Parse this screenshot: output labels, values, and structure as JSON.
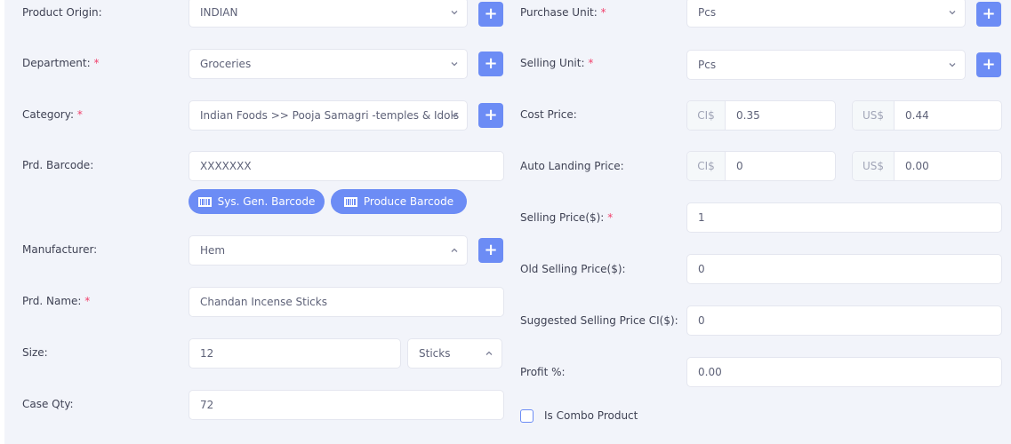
{
  "colors": {
    "accent": "#6c8cf5",
    "required": "#f1416c",
    "background": "#f2f4fa",
    "border": "#e4e6ef"
  },
  "left": {
    "product_origin": {
      "label": "Product Origin:",
      "value": "INDIAN"
    },
    "department": {
      "label": "Department:",
      "value": "Groceries"
    },
    "category": {
      "label": "Category:",
      "value": "Indian Foods >> Pooja Samagri -temples & Idols"
    },
    "barcode": {
      "label": "Prd. Barcode:",
      "value": "XXXXXXX",
      "sys_gen_label": "Sys. Gen. Barcode",
      "produce_label": "Produce Barcode"
    },
    "manufacturer": {
      "label": "Manufacturer:",
      "value": "Hem"
    },
    "prd_name": {
      "label": "Prd. Name:",
      "value": "Chandan Incense Sticks"
    },
    "size": {
      "label": "Size:",
      "value": "12",
      "unit": "Sticks"
    },
    "case_qty": {
      "label": "Case Qty:",
      "value": "72"
    },
    "required_mark": "*",
    "add_symbol": "+"
  },
  "right": {
    "purchase_unit": {
      "label": "Purchase Unit:",
      "value": "Pcs"
    },
    "selling_unit": {
      "label": "Selling Unit:",
      "value": "Pcs"
    },
    "cost_price": {
      "label": "Cost Price:",
      "ci_prefix": "CI$",
      "ci_value": "0.35",
      "us_prefix": "US$",
      "us_value": "0.44"
    },
    "auto_landing": {
      "label": "Auto Landing Price:",
      "ci_prefix": "CI$",
      "ci_value": "0",
      "us_prefix": "US$",
      "us_value": "0.00"
    },
    "selling_price": {
      "label": "Selling Price($):",
      "value": "1"
    },
    "old_selling_price": {
      "label": "Old Selling Price($):",
      "value": "0"
    },
    "suggested_price": {
      "label": "Suggested Selling Price CI($):",
      "value": "0"
    },
    "profit": {
      "label": "Profit %:",
      "value": "0.00"
    },
    "combo": {
      "label": "Is Combo Product",
      "checked": false
    }
  }
}
